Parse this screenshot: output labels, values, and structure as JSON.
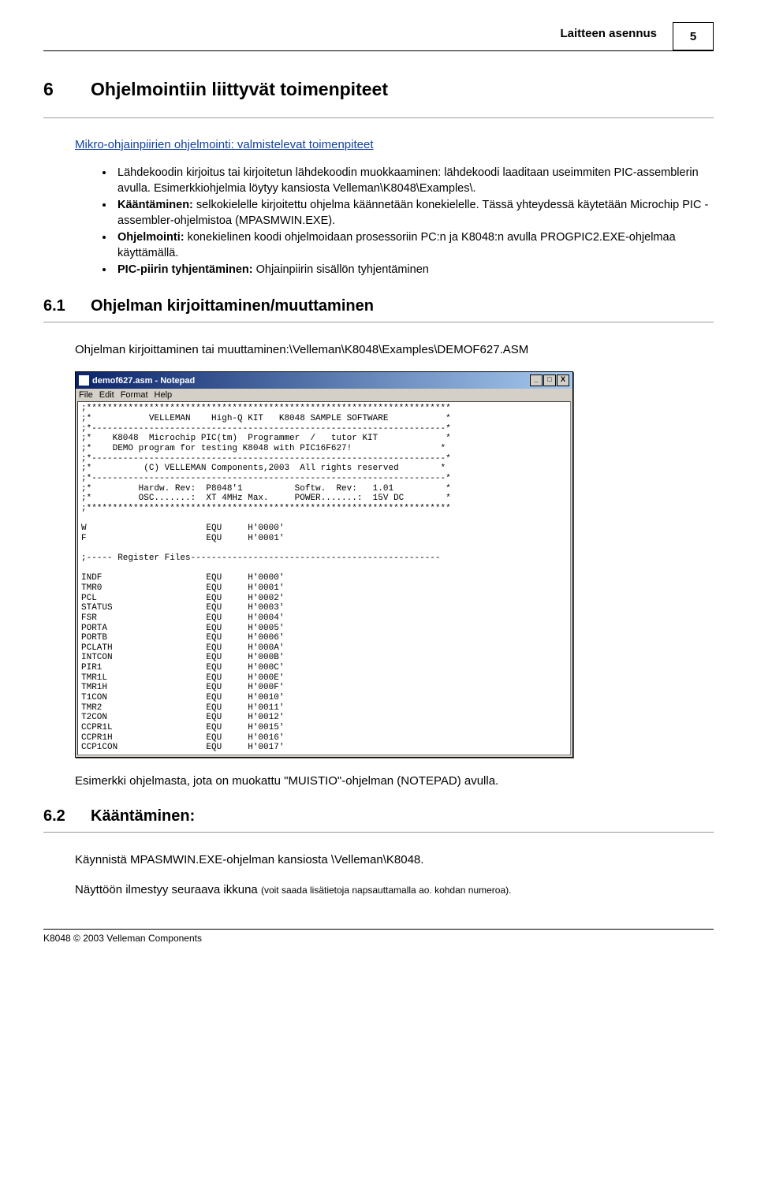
{
  "header": {
    "section_title": "Laitteen asennus",
    "page_number": "5"
  },
  "h1": {
    "num": "6",
    "title": "Ohjelmointiin liittyvät toimenpiteet"
  },
  "sub1": {
    "heading": "Mikro-ohjainpiirien ohjelmointi: valmistelevat toimenpiteet",
    "bullets": {
      "b0": "Lähdekoodin kirjoitus tai kirjoitetun lähdekoodin muokkaaminen: lähdekoodi laaditaan useimmiten PIC-assemblerin avulla. Esimerkkiohjelmia löytyy kansiosta Velleman\\K8048\\Examples\\.",
      "b1_strong": "Kääntäminen:",
      "b1_rest": " selkokielelle kirjoitettu ohjelma käännetään konekielelle. Tässä yhteydessä käytetään Microchip PIC -assembler-ohjelmistoa (MPASMWIN.EXE).",
      "b2_strong": "Ohjelmointi:",
      "b2_rest": " konekielinen koodi ohjelmoidaan prosessoriin PC:n ja K8048:n avulla PROGPIC2.EXE-ohjelmaa käyttämällä.",
      "b3_strong": "PIC-piirin tyhjentäminen:",
      "b3_rest": " Ohjainpiirin sisällön tyhjentäminen"
    }
  },
  "h2_1": {
    "num": "6.1",
    "title": "Ohjelman kirjoittaminen/muuttaminen",
    "intro": "Ohjelman kirjoittaminen tai muuttaminen:\\Velleman\\K8048\\Examples\\DEMOF627.ASM",
    "after_text": "Esimerkki ohjelmasta, jota on muokattu \"MUISTIO\"-ohjelman (NOTEPAD) avulla."
  },
  "notepad": {
    "title": "demof627.asm - Notepad",
    "menu": {
      "m0": "File",
      "m1": "Edit",
      "m2": "Format",
      "m3": "Help"
    },
    "btn_min": "_",
    "btn_max": "□",
    "btn_close": "X",
    "content": ";**********************************************************************\n;*           VELLEMAN    High-Q KIT   K8048 SAMPLE SOFTWARE           *\n;*--------------------------------------------------------------------*\n;*    K8048  Microchip PIC(tm)  Programmer  /   tutor KIT             *\n;*    DEMO program for testing K8048 with PIC16F627!                 *\n;*--------------------------------------------------------------------*\n;*          (C) VELLEMAN Components,2003  All rights reserved        *\n;*--------------------------------------------------------------------*\n;*         Hardw. Rev:  P8048'1          Softw.  Rev:   1.01          *\n;*         OSC.......:  XT 4MHz Max.     POWER.......:  15V DC        *\n;**********************************************************************\n\nW                       EQU     H'0000'\nF                       EQU     H'0001'\n\n;----- Register Files------------------------------------------------\n\nINDF                    EQU     H'0000'\nTMR0                    EQU     H'0001'\nPCL                     EQU     H'0002'\nSTATUS                  EQU     H'0003'\nFSR                     EQU     H'0004'\nPORTA                   EQU     H'0005'\nPORTB                   EQU     H'0006'\nPCLATH                  EQU     H'000A'\nINTCON                  EQU     H'000B'\nPIR1                    EQU     H'000C'\nTMR1L                   EQU     H'000E'\nTMR1H                   EQU     H'000F'\nT1CON                   EQU     H'0010'\nTMR2                    EQU     H'0011'\nT2CON                   EQU     H'0012'\nCCPR1L                  EQU     H'0015'\nCCPR1H                  EQU     H'0016'\nCCP1CON                 EQU     H'0017'"
  },
  "h2_2": {
    "num": "6.2",
    "title": "Kääntäminen:",
    "p1": "Käynnistä MPASMWIN.EXE-ohjelman kansiosta \\Velleman\\K8048.",
    "p2a": "Näyttöön ilmestyy seuraava ikkuna ",
    "p2b": "(voit saada lisätietoja napsauttamalla ao. kohdan numeroa)."
  },
  "footer": {
    "text": "K8048 © 2003 Velleman Components"
  }
}
